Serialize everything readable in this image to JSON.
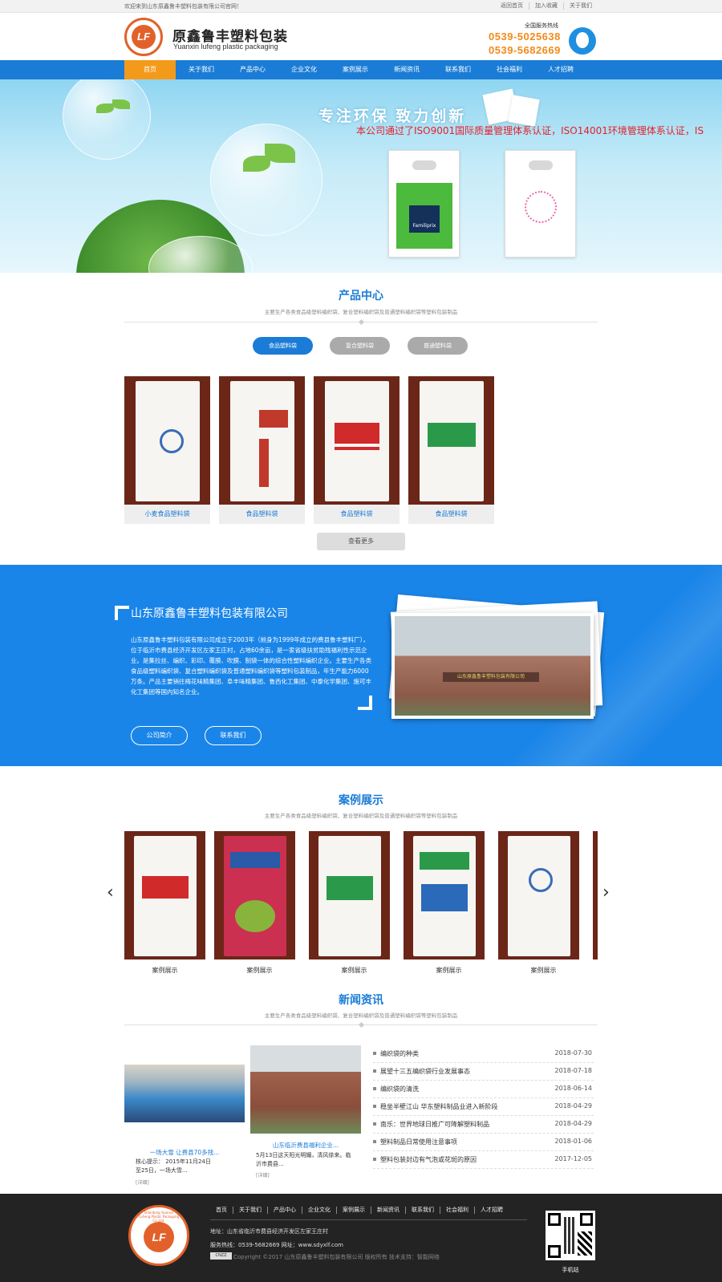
{
  "topbar": {
    "welcome": "欢迎来到山东原鑫鲁丰塑料包装有限公司官网！",
    "links": [
      "返回首页",
      "加入收藏",
      "关于我们"
    ]
  },
  "header": {
    "logo_cn": "原鑫鲁丰塑料包装",
    "logo_en": "Yuanxin lufeng plastic packaging",
    "logo_mark": "LF",
    "hotline_label": "全国服务热线",
    "phones": [
      "0539-5025638",
      "0539-5682669"
    ]
  },
  "nav": {
    "items": [
      "首页",
      "关于我们",
      "产品中心",
      "企业文化",
      "案例展示",
      "新闻资讯",
      "联系我们",
      "社会福利",
      "人才招聘"
    ],
    "active": 0
  },
  "banner": {
    "slogan": "专注环保 致力创新",
    "marquee": "本公司通过了ISO9001国际质量管理体系认证，ISO14001环境管理体系认证，IS",
    "bag_brand": "Familiprix"
  },
  "products": {
    "title": "产品中心",
    "subtitle": "主要生产各类食品级塑料编织袋、复合塑料编织袋及普通塑料编织袋等塑料包装制品",
    "tabs": [
      "食品塑料袋",
      "复合塑料袋",
      "普通塑料袋"
    ],
    "active_tab": 0,
    "items": [
      "小麦食品塑料袋",
      "食品塑料袋",
      "食品塑料袋",
      "食品塑料袋"
    ],
    "more": "查看更多"
  },
  "about": {
    "title": "山东原鑫鲁丰塑料包装有限公司",
    "text": "山东原鑫鲁丰塑料包装有限公司成立于2003年（前身为1999年成立的费县鲁丰塑料厂），位于临沂市费县经济开发区左家王庄村，占地60余亩，是一家省级扶贫助残福利性示范企业。是集拉丝、编织、彩印、覆膜、吹膜、制袋一体的综合性塑料编织企业。主要生产各类食品级塑料编织袋、复合塑料编织袋及普通塑料编织袋等塑料包装制品，年生产能力6000万条。产品主要销往梅花味精集团、阜丰味精集团、鲁西化工集团、中泰化学集团、施可丰化工集团等国内知名企业。",
    "buttons": [
      "公司简介",
      "联系我们"
    ],
    "photo_sign": "山东原鑫鲁丰塑料包装有限公司"
  },
  "cases": {
    "title": "案例展示",
    "subtitle": "主要生产各类食品级塑料编织袋、复合塑料编织袋及普通塑料编织袋等塑料包装制品",
    "items": [
      "案例展示",
      "案例展示",
      "案例展示",
      "案例展示",
      "案例展示"
    ],
    "prev_icon": "‹",
    "next_icon": "›"
  },
  "news": {
    "title": "新闻资讯",
    "subtitle": "主要生产各类食品级塑料编织袋、复合塑料编织袋及普通塑料编织袋等塑料包装制品",
    "feature1": {
      "title": "一场大雪 让费县70多残...",
      "summary": "核心提示： 2015年11月24日至25日，一场大雪...",
      "more": "[详细]"
    },
    "feature2": {
      "title": "山东临沂费县福利企业...",
      "summary": "5月13日这天阳光明媚，清风徐来。临沂市费县...",
      "more": "[详细]"
    },
    "list": [
      {
        "t": "编织袋的种类",
        "d": "2018-07-30"
      },
      {
        "t": "展望十三五编织袋行业发展事态",
        "d": "2018-07-18"
      },
      {
        "t": "编织袋的清洗",
        "d": "2018-06-14"
      },
      {
        "t": "稳坐半壁江山 华东塑料制品业进入新阶段",
        "d": "2018-04-29"
      },
      {
        "t": "南乐：世界地球日推广可降解塑料制品",
        "d": "2018-04-29"
      },
      {
        "t": "塑料制品日常使用注意事项",
        "d": "2018-01-06"
      },
      {
        "t": "塑料包装封边有气泡或花斑的原因",
        "d": "2017-12-05"
      }
    ]
  },
  "footer": {
    "nav": [
      "首页",
      "关于我们",
      "产品中心",
      "企业文化",
      "案例展示",
      "新闻资讯",
      "联系我们",
      "社会福利",
      "人才招聘"
    ],
    "address": "地址：山东省临沂市费县经济开发区左家王庄村",
    "contact": "服务热线：0539-5682669 网址：www.sdyxlf.com",
    "copyright": "Copyright ©2017 山东原鑫鲁丰塑料包装有限公司 版权所有 技术支持：智能网络",
    "cnzz": "CNZZ",
    "qr_label": "手机站",
    "seal_text": "Shandong Yuanxin LuFeng Plastic Packaging Co.,Ltd.",
    "seal_mark": "LF"
  }
}
